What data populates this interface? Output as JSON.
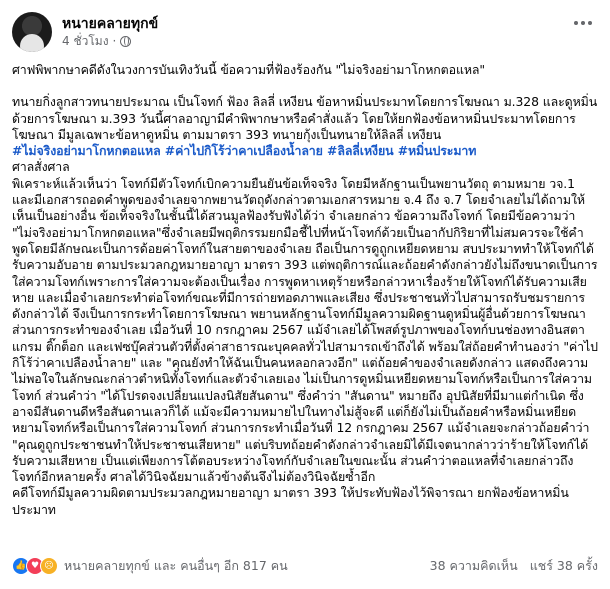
{
  "post": {
    "author": "หนายคลายทุกข์",
    "time": "4 ชั่วโมง",
    "paragraphs": [
      "ศาฟพิพากษาคดีดังในวงการบันเทิงวันนี้ ข้อความที่ฟ้องร้องกัน \"ไม่จริงอย่ามาโกหกตอแหล\"",
      "ทนายกิ่งลูกสาวทนายประมาณ เป็นโจทก์ ฟ้อง ลิลลี่ เหงียน ข้อหาหมิ่นประมาทโดยการโฆษณา ม.328 และดูหมิ่นด้วยการโฆษณา ม.393 วันนี้ศาลอาญามีคำพิพากษาหรือคำสั่งแล้ว โดยให้ยกฟ้องข้อหาหมิ่นประมาทโดยการโฆษณา มีมูลเฉพาะข้อหาดูหมิ่น ตามมาตรา 393 ทนายกุ้งเป็นทนายให้ลิลลี่ เหงียน"
    ],
    "hashtags": "#ไม่จริงอย่ามาโกหกตอแหล #ค่าไปกิโร้ว่าคาเปลืองน้ำลาย #ลิลลี่เหงียน #หมิ่นประมาท",
    "order_heading": "ศาลสั่งศาล",
    "order_text": "พิเคราะห์แล้วเห็นว่า โจทก์มีตัวโจทก์เบิกความยืนยันข้อเท็จจริง โดยมีหลักฐานเป็นพยานวัตถุ ตามหมาย วจ.1 และมีเอกสารถอดคำพูดของจำเลยจากพยานวัตถุดังกล่าวตามเอกสารหมาย จ.4 ถึง จ.7 โดยจำเลยไม่ได้ถามให้เห็นเป็นอย่างอื่น ข้อเท็จจริงในชั้นนี้ได้สวนมูลฟ้องรับฟังได้ว่า จำเลยกล่าว ข้อความถึงโจทก์ โดยมีข้อความว่า \"ไม่จริงอย่ามาโกหกตอแหล\"ซึ่งจำเลยมีพฤติกรรมยกมือชี้ไปที่หน้าโจทก์ด้วยเป็นอากัปกิริยาที่ไม่สมควรจะใช้คำพูดโดยมีลักษณะเป็นการด้อยค่าโจทก์ในสายตาของจำเลย ถือเป็นการดูถูกเหยียดหยาม สบประมาททำให้โจทก์ได้รับความอับอาย ตามประมวลกฎหมายอาญา มาตรา 393 แต่พฤติการณ์และถ้อยคำดังกล่าวยังไม่ถึงขนาดเป็นการใส่ความโจทก์เพราะการใส่ความจะต้องเป็นเรื่อง การพูดหาเหตุร้ายหรือกล่าวหาเรื่องร้ายให้โจทก์ได้รับความเสียหาย และเมื่อจำเลยกระทำต่อโจทก์ขณะที่มีการถ่ายทอดภาพและเสียง ซึ่งประชาชนทั่วไปสามารถรับชมรายการ ดังกล่าวได้ จึงเป็นการกระทำโดยการโฆษณา พยานหลักฐานโจทก์มีมูลความผิดฐานดูหมิ่นผู้อื่นด้วยการโฆษณา ส่วนการกระทำของจำเลย เมื่อวันที่ 10 กรกฎาคม 2567 แม้จำเลยได้โพสต์รูปภาพของโจทก์บนช่องทางอินสตาแกรม ติ๊กต็อก และเฟซบุ๊คส่วนตัวที่ตั้งค่าสาธารณะบุคคลทั่วไปสามารถเข้าถึงได้ พร้อมใส่ถ้อยคำทำนองว่า \"ค่าไปกิโร้ว่าคาเปลืองน้ำลาย\" และ \"คุณยังทำให้ฉันเป็นคนหลอกลวงอีก\" แต่ถ้อยคำของจำเลยดังกล่าว แสดงถึงความไม่พอใจในลักษณะกล่าวตำหนิทั้งโจทก์และตัวจำเลยเอง ไม่เป็นการดูหมิ่นเหยียดหยามโจทก์หรือเป็นการใส่ความโจทก์ ส่วนคำว่า \"ได้โปรดจงเปลี่ยนแปลงนิสัยสันดาน\" ซึ่งคำว่า \"สันดาน\" หมายถึง อุปนิสัยที่มีมาแต่กำเนิด ซึ่งอาจมีสันดานดีหรือสันดานเลวก็ได้ แม้จะมีความหมายไปในทางไม่สู้จะดี แต่ก็ยังไม่เป็นถ้อยคำหรือหมิ่นเหยียดหยามโจทก์หรือเป็นการใส่ความโจทก์ ส่วนการกระทำเมื่อวันที่ 12 กรกฎาคม 2567 แม้จำเลยจะกล่าวถ้อยคำว่า \"คุณดูถูกประชาชนทำให้ประชาชนเสียหาย\" แต่บริบทถ้อยคำดังกล่าวจำเลยมิได้มีเจตนากล่าวว่าร้ายให้โจทก์ได้รับความเสียหาย เป็นแต่เพียงการโต้ตอบระหว่างโจทก์กับจำเลยในขณะนั้น ส่วนคำว่าตอแหลที่จำเลยกล่าวถึงโจทก์อีกหลายครั้ง ศาลได้วินิจฉัยมาแล้วข้างต้นจึงไม่ต้องวินิจฉัยซ้ำอีก",
    "conclusion": "คดีโจทก์มีมูลความผิดตามประมวลกฎหมายอาญา มาตรา 393 ให้ประทับฟ้องไว้พิจารณา ยกฟ้องข้อหาหมิ่นประมาท",
    "reactions_text": "หนายคลายทุกข์ และ คนอื่นๆ อีก 817 คน",
    "comments_count": "38 ความคิดเห็น",
    "shares_count": "แชร์ 38 ครั้ง"
  },
  "colors": {
    "hashtag": "#1a5ac9",
    "meta": "#65676b",
    "like": "#1877f2",
    "love": "#f33e58",
    "sad": "#f7b125"
  },
  "icons": [
    "globe-icon",
    "more-icon",
    "like-icon",
    "love-icon",
    "sad-icon"
  ]
}
